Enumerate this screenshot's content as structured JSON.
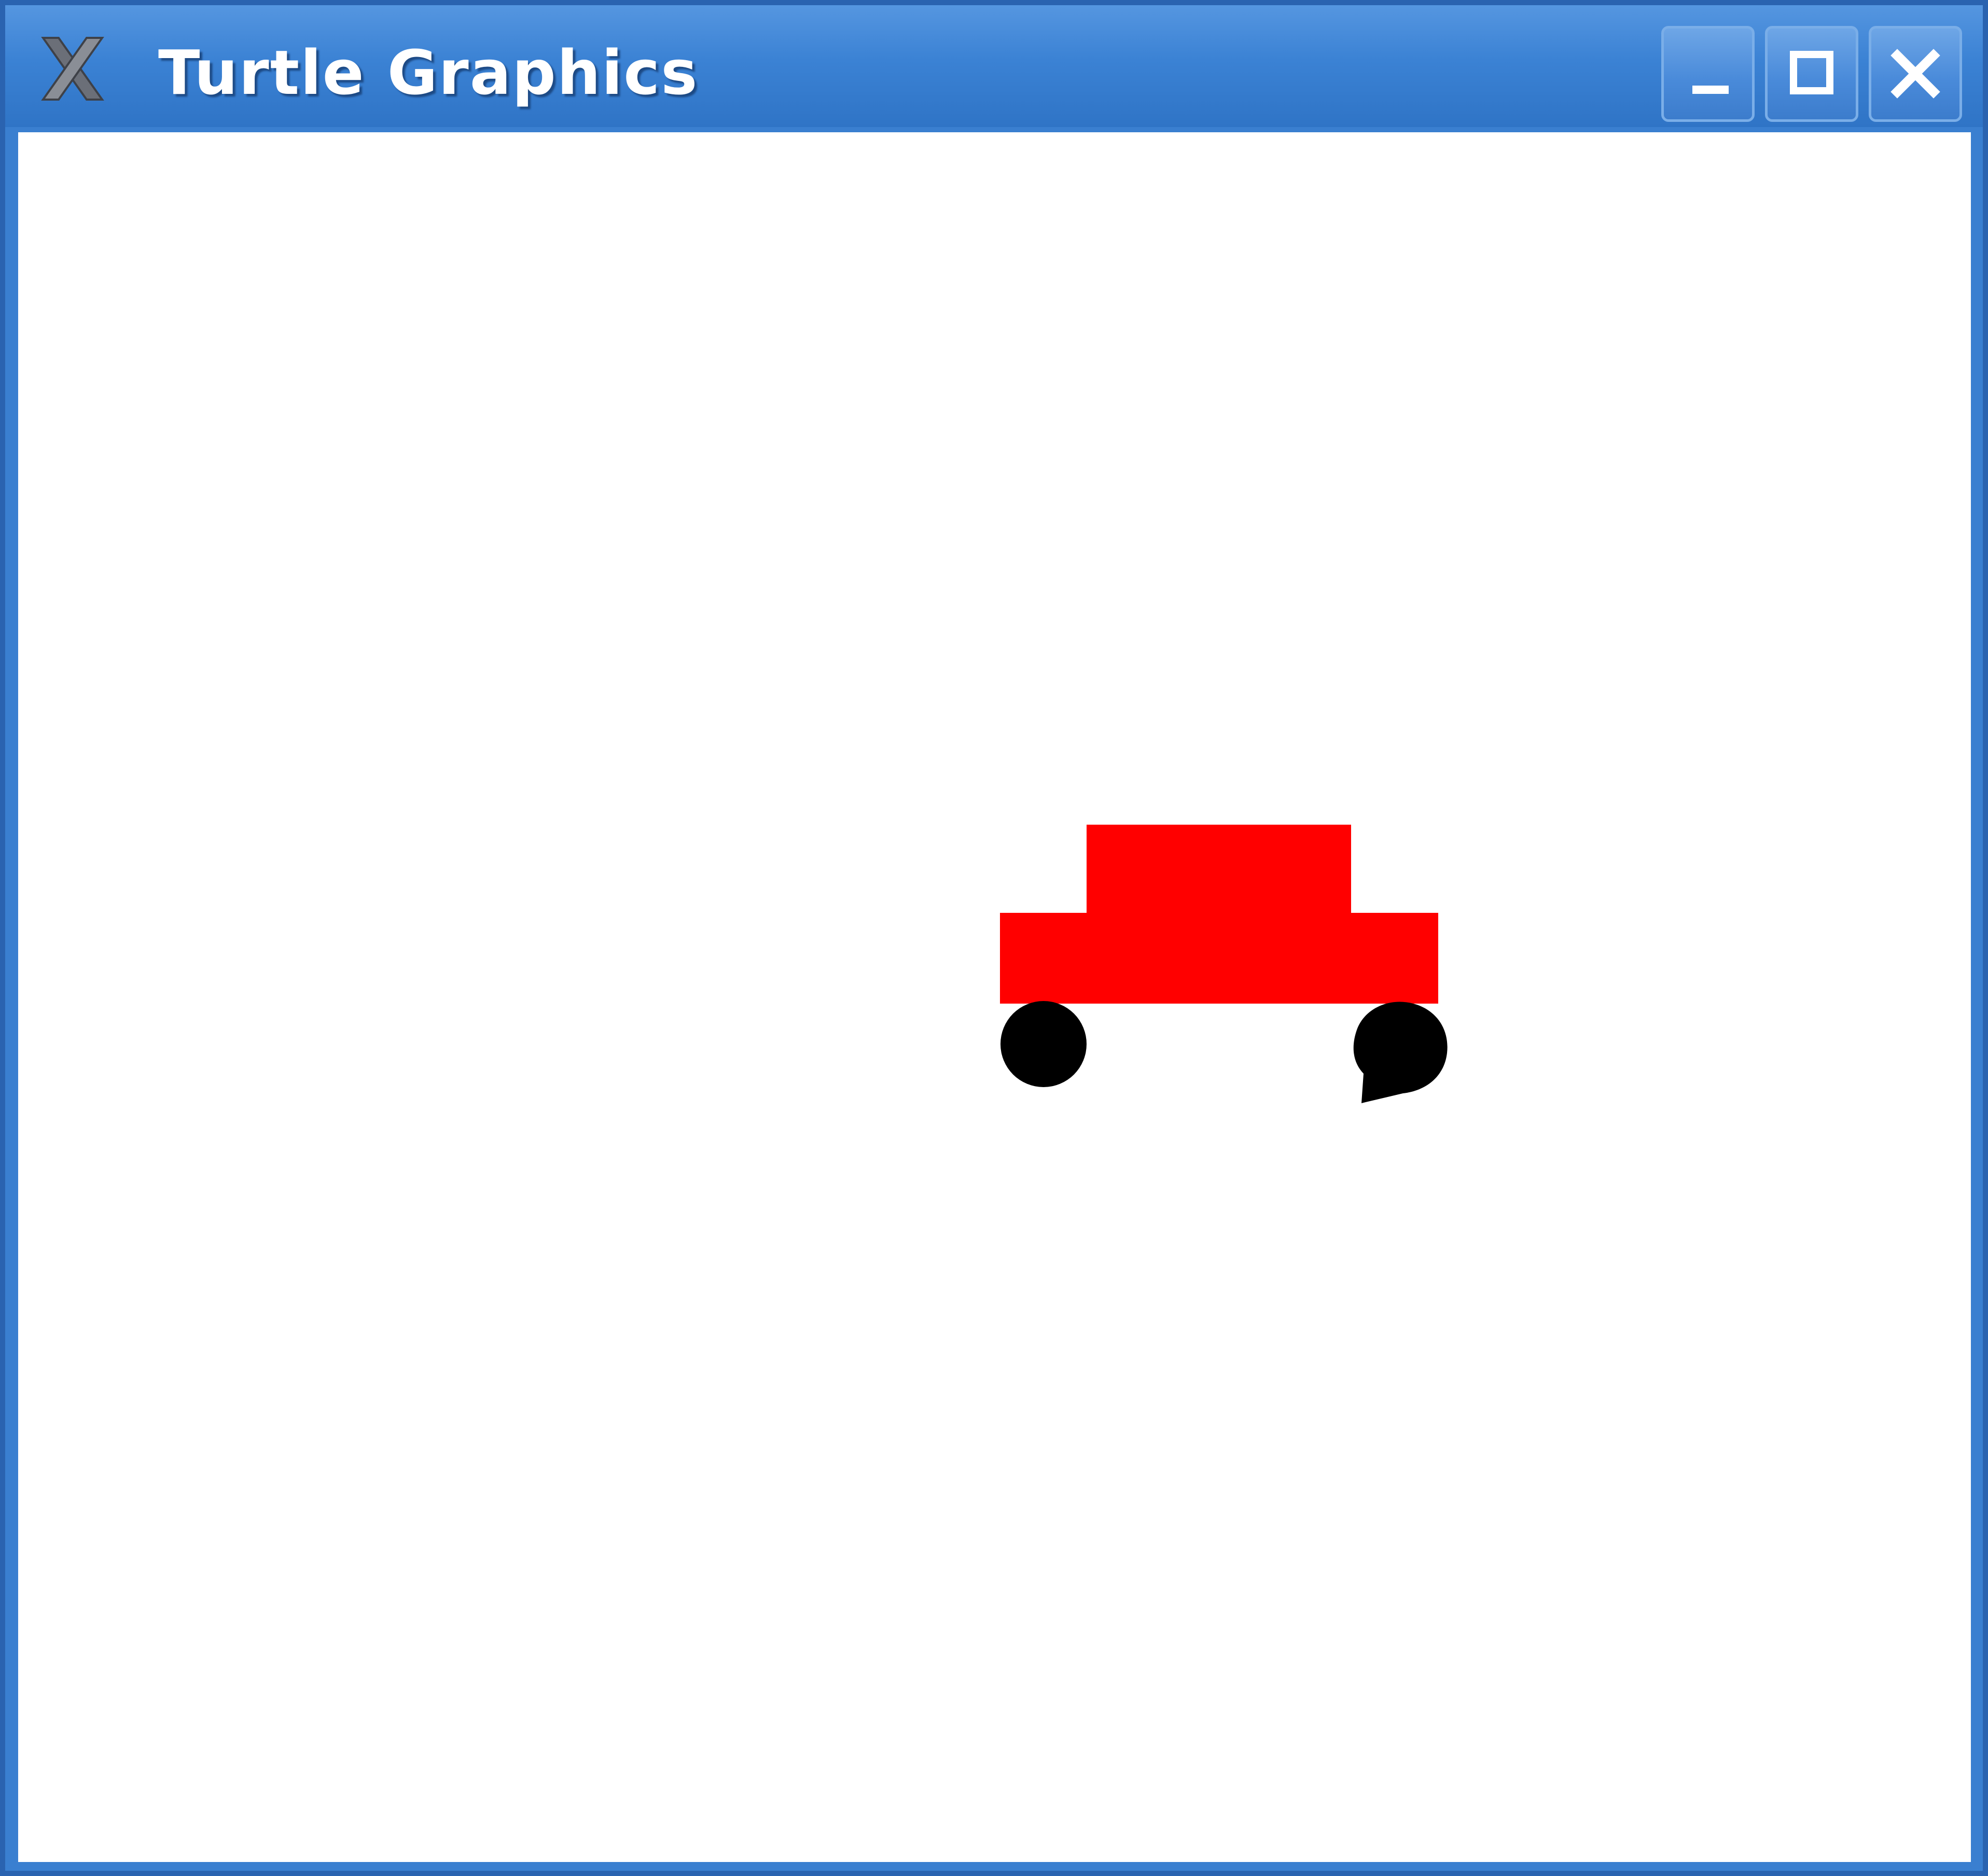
{
  "window": {
    "title": "Turtle Graphics",
    "app_icon": "x-logo-icon",
    "controls": {
      "minimize_icon": "minimize-icon",
      "maximize_icon": "maximize-icon",
      "close_icon": "close-icon"
    }
  },
  "canvas": {
    "background": "#ffffff",
    "drawing": {
      "subject": "car",
      "body_color": "#ff0000",
      "wheel_color": "#000000"
    }
  },
  "colors": {
    "titlebar": "#3b82d4",
    "border": "#2a63b0",
    "title_text": "#ffffff"
  }
}
